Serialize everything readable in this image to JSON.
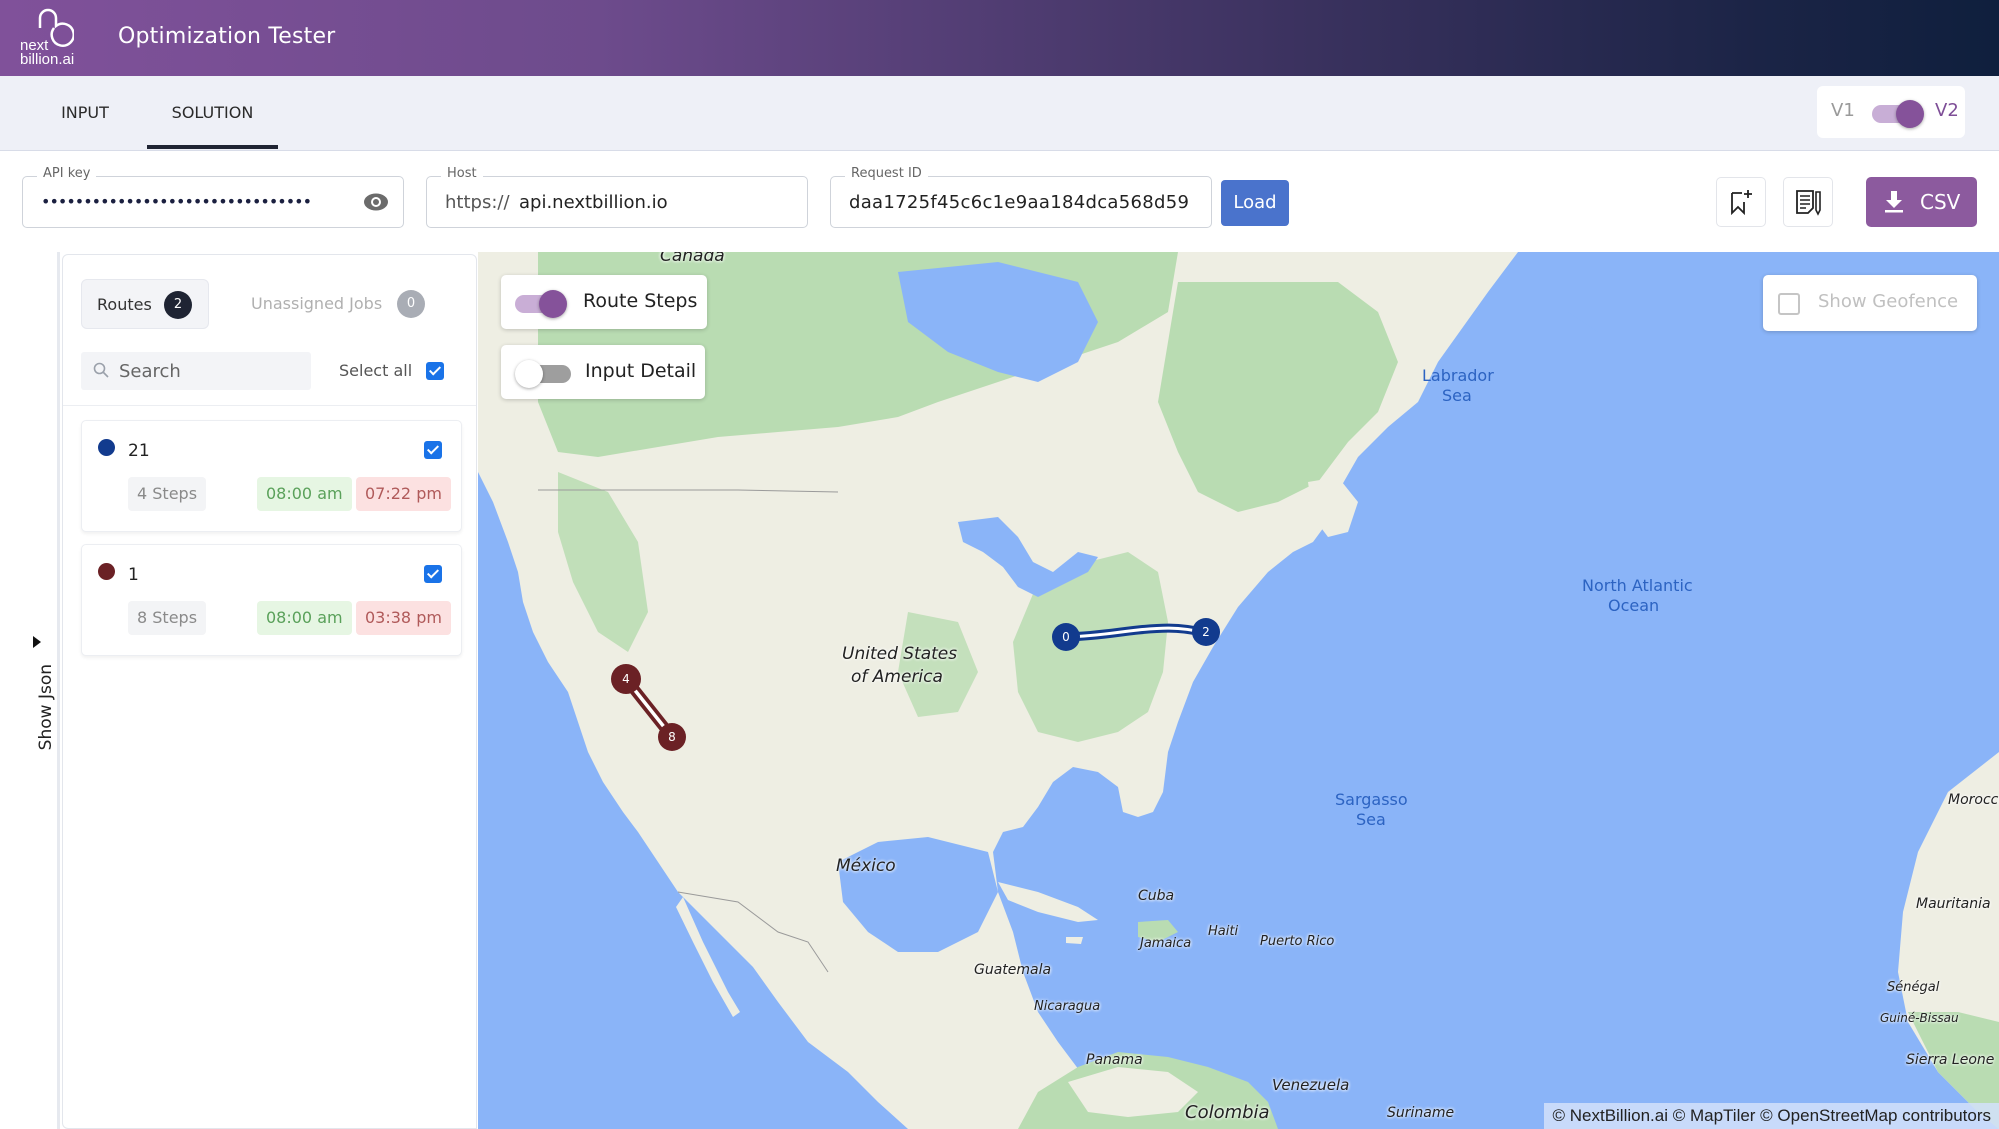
{
  "header": {
    "logo_line1": "next",
    "logo_line2": "billion.ai",
    "title": "Optimization Tester"
  },
  "tabs": [
    {
      "label": "INPUT",
      "active": false
    },
    {
      "label": "SOLUTION",
      "active": true
    }
  ],
  "version_toggle": {
    "left_label": "V1",
    "right_label": "V2",
    "selected": "V2"
  },
  "fields": {
    "api_key": {
      "legend": "API key",
      "value": "••••••••••••••••••••••••••••••••",
      "masked": true
    },
    "host": {
      "legend": "Host",
      "prefix": "https://",
      "value": "api.nextbillion.io"
    },
    "request_id": {
      "legend": "Request ID",
      "value": "daa1725f45c6c1e9aa184dca568d59"
    }
  },
  "toolbar": {
    "load_label": "Load",
    "csv_label": "CSV",
    "bookmark_icon": "bookmark-add-icon",
    "notes_icon": "notes-edit-icon"
  },
  "side": {
    "show_json_label": "Show Json"
  },
  "panel": {
    "routes_tab": {
      "label": "Routes",
      "count": "2"
    },
    "unassigned_tab": {
      "label": "Unassigned Jobs",
      "count": "0"
    },
    "search_placeholder": "Search",
    "select_all_label": "Select all",
    "select_all_checked": true,
    "routes": [
      {
        "name": "21",
        "color": "#123b8e",
        "steps": "4 Steps",
        "start": "08:00 am",
        "end": "07:22 pm",
        "checked": true
      },
      {
        "name": "1",
        "color": "#6b2125",
        "steps": "8 Steps",
        "start": "08:00 am",
        "end": "03:38 pm",
        "checked": true
      }
    ]
  },
  "map_controls": {
    "route_steps": {
      "label": "Route Steps",
      "on": true
    },
    "input_detail": {
      "label": "Input Detail",
      "on": false
    },
    "show_geofence": {
      "label": "Show Geofence",
      "checked": false
    }
  },
  "map": {
    "labels": {
      "canada": "Canada",
      "usa_1": "United States",
      "usa_2": "of America",
      "mexico": "México",
      "cuba": "Cuba",
      "jamaica": "Jamaica",
      "haiti": "Haiti",
      "puerto_rico": "Puerto Rico",
      "guatemala": "Guatemala",
      "nicaragua": "Nicaragua",
      "panama": "Panama",
      "venezuela": "Venezuela",
      "colombia": "Colombia",
      "suriname": "Suriname",
      "morocco": "Morocco",
      "mauritania": "Mauritania",
      "senegal": "Sénégal",
      "guinea_bissau": "Guiné-Bissau",
      "sierra_leone": "Sierra Leone",
      "labrador_1": "Labrador",
      "labrador_2": "Sea",
      "atlantic_1": "North Atlantic",
      "atlantic_2": "Ocean",
      "sargasso_1": "Sargasso",
      "sargasso_2": "Sea"
    },
    "markers": [
      {
        "route": "21",
        "label": "0",
        "color": "#123b8e"
      },
      {
        "route": "21",
        "label": "2",
        "color": "#123b8e"
      },
      {
        "route": "1",
        "label": "4",
        "color": "#6b2125"
      },
      {
        "route": "1",
        "label": "8",
        "color": "#6b2125"
      }
    ],
    "attribution": "© NextBillion.ai © MapTiler © OpenStreetMap contributors"
  },
  "colors": {
    "brand_purple": "#85529a",
    "load_blue": "#4a73cc",
    "water": "#8ab4f8",
    "land": "#eeeee3",
    "forest": "#b9dcb2"
  }
}
